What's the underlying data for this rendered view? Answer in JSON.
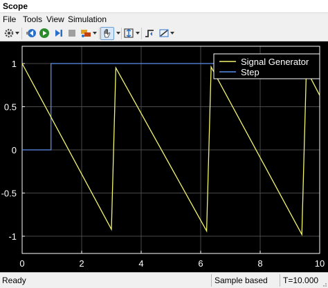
{
  "window": {
    "title": "Scope"
  },
  "menu": {
    "items": [
      "File",
      "Tools",
      "View",
      "Simulation"
    ]
  },
  "toolbar": {
    "buttons": [
      {
        "icon": "settings-gear-icon"
      },
      {
        "icon": "step-back-icon"
      },
      {
        "icon": "run-icon"
      },
      {
        "icon": "step-forward-icon"
      },
      {
        "icon": "stop-icon"
      },
      {
        "icon": "highlight-icon"
      },
      {
        "icon": "zoom-pan-hand-icon"
      },
      {
        "icon": "autoscale-icon"
      },
      {
        "icon": "trigger-icon"
      },
      {
        "icon": "measurement-icon"
      }
    ],
    "accent": "#2a8c2a"
  },
  "status": {
    "left": "Ready",
    "mode": "Sample based",
    "time": "T=10.000"
  },
  "chart_data": {
    "type": "line",
    "background": "#000000",
    "axes_color": "#ffffff",
    "grid": true,
    "grid_color": "#4a4a4a",
    "xlim": [
      0,
      10
    ],
    "ylim": [
      -1.2,
      1.2
    ],
    "x_ticks": [
      "0",
      "2",
      "4",
      "6",
      "8",
      "10"
    ],
    "y_ticks": [
      "1",
      "0.5",
      "0",
      "-0.5",
      "-1"
    ],
    "x_tick_values": [
      0,
      2,
      4,
      6,
      8,
      10
    ],
    "y_tick_values": [
      1,
      0.5,
      0,
      -0.5,
      -1
    ],
    "legend": {
      "position": "top-right"
    },
    "series": [
      {
        "name": "Signal Generator",
        "color": "#f5f56e",
        "x": [
          0,
          3.0,
          3.15,
          6.2,
          6.35,
          9.4,
          9.55,
          10
        ],
        "y": [
          1.0,
          -0.92,
          0.95,
          -0.94,
          0.96,
          -0.98,
          0.93,
          0.63
        ]
      },
      {
        "name": "Step",
        "color": "#5a8ff0",
        "x": [
          0,
          0.97,
          0.97,
          10
        ],
        "y": [
          0,
          0,
          1,
          1
        ]
      }
    ]
  }
}
